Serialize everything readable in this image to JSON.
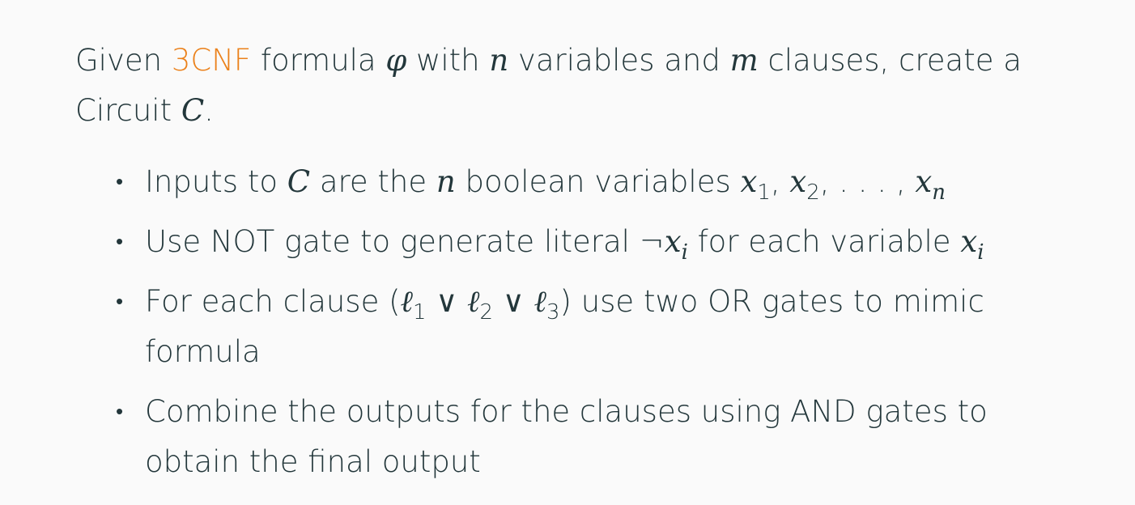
{
  "intro": {
    "t1": "Given ",
    "accent": "3CNF",
    "t2": " formula ",
    "phi": "φ",
    "t3": " with ",
    "n": "n",
    "t4": " variables and ",
    "m": "m",
    "t5": " clauses, create a Circuit ",
    "C": "C",
    "t6": "."
  },
  "bullets": [
    {
      "marker": "•",
      "t1": "Inputs to ",
      "C": "C",
      "t2": " are the ",
      "n": "n",
      "t3": " boolean variables ",
      "x": "x",
      "s1": "1",
      "comma": ", ",
      "s2": "2",
      "dots": ", . . . , ",
      "sn": "n"
    },
    {
      "marker": "•",
      "t1": "Use NOT gate to generate literal ",
      "neg": "¬",
      "x": "x",
      "i": "i",
      "t2": " for each variable "
    },
    {
      "marker": "•",
      "t1": "For each clause (",
      "ell": "ℓ",
      "s1": "1",
      "or": " ∨ ",
      "s2": "2",
      "s3": "3",
      "t2": ") use two OR gates to mimic formula"
    },
    {
      "marker": "•",
      "t1": "Combine the outputs for the clauses using AND gates to obtain the final output"
    }
  ]
}
